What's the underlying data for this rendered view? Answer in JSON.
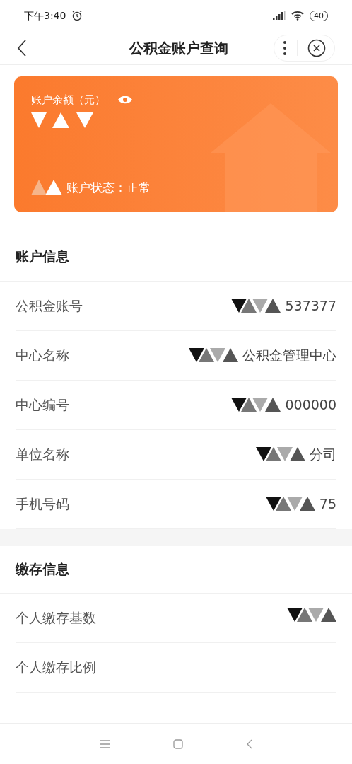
{
  "status_bar": {
    "time": "下午3:40",
    "battery": "40"
  },
  "header": {
    "title": "公积金账户查询"
  },
  "card": {
    "balance_label": "账户余额（元）",
    "status": "账户状态：正常"
  },
  "sections": [
    {
      "title": "账户信息",
      "rows": [
        {
          "label": "公积金账号",
          "value": "537377",
          "redacted": true
        },
        {
          "label": "中心名称",
          "value": "公积金管理中心",
          "redacted": true
        },
        {
          "label": "中心编号",
          "value": "000000",
          "redacted": true
        },
        {
          "label": "单位名称",
          "value": "分司",
          "redacted": true
        },
        {
          "label": "手机号码",
          "value": "75",
          "redacted": true
        }
      ]
    },
    {
      "title": "缴存信息",
      "rows": [
        {
          "label": "个人缴存基数",
          "value": "",
          "redacted": true
        },
        {
          "label": "个人缴存比例",
          "value": "",
          "redacted": false
        }
      ]
    }
  ]
}
